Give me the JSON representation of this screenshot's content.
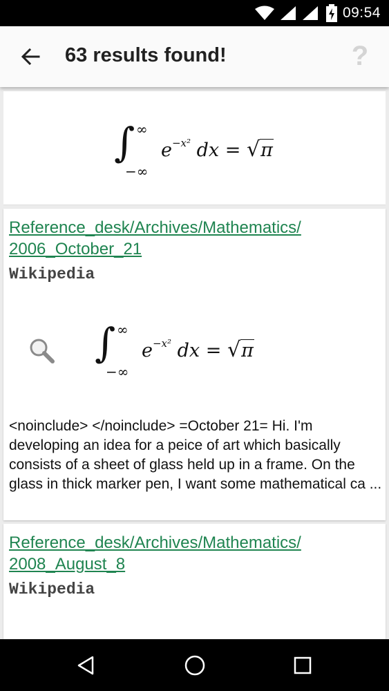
{
  "status_bar": {
    "time": "09:54",
    "icons": [
      "wifi-icon",
      "signal-icon",
      "signal-icon-2",
      "battery-charging-icon"
    ]
  },
  "app_bar": {
    "title": "63 results found!",
    "back_icon": "arrow-back-icon",
    "help_icon": "help-icon",
    "help_label": "?"
  },
  "query": {
    "lower": "−∞",
    "upper": "∞",
    "base": "e",
    "exponent": "−x²",
    "differential": "dx",
    "equals": "=",
    "sqrt_symbol": "√",
    "radicand": "π"
  },
  "results": [
    {
      "title_line1": "Reference_desk/Archives/Mathematics/",
      "title_line2": "2006_October_21",
      "source": "Wikipedia",
      "snippet": "<noinclude> </noinclude> =October 21= Hi. I'm developing an idea for a peice of art which basically consists of a sheet of glass held up in a frame. On the glass in thick marker pen, I want some mathematical ca ...",
      "formula_icon": "search-icon"
    },
    {
      "title_line1": "Reference_desk/Archives/Mathematics/",
      "title_line2": "2008_August_8",
      "source": "Wikipedia"
    }
  ],
  "nav_bar": {
    "back": "nav-back-icon",
    "home": "nav-home-icon",
    "recents": "nav-recents-icon"
  },
  "colors": {
    "link": "#1f8450",
    "status_bar": "#000000",
    "app_bar": "#fafafa",
    "help_icon": "#d4d4d4"
  }
}
